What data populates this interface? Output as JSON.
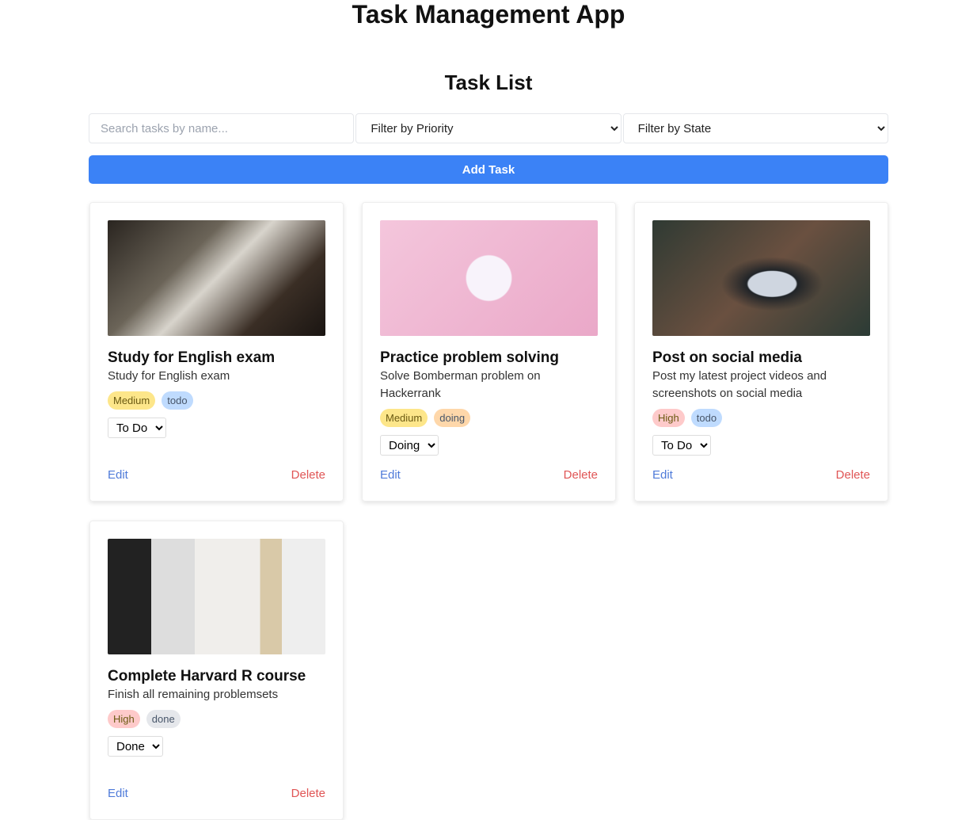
{
  "app_title": "Task Management App",
  "list_title": "Task List",
  "search": {
    "placeholder": "Search tasks by name..."
  },
  "filters": {
    "priority": "Filter by Priority",
    "state": "Filter by State"
  },
  "add_label": "Add Task",
  "edit_label": "Edit",
  "delete_label": "Delete",
  "colors": {
    "accent": "#3b82f6",
    "medium_bg": "#fde68a",
    "high_bg": "#fecaca",
    "todo_bg": "#bfdbfe",
    "doing_bg": "#fed7aa",
    "done_bg": "#e5e7eb"
  },
  "tasks": [
    {
      "title": "Study for English exam",
      "desc": "Study for English exam",
      "priority": "Medium",
      "status": "todo",
      "state": "To Do",
      "image": "book-photo"
    },
    {
      "title": "Practice problem solving",
      "desc": "Solve Bomberman problem on Hackerrank",
      "priority": "Medium",
      "status": "doing",
      "state": "Doing",
      "image": "code-illustration"
    },
    {
      "title": "Post on social media",
      "desc": "Post my latest project videos and screenshots on social media",
      "priority": "High",
      "status": "todo",
      "state": "To Do",
      "image": "phone-photo"
    },
    {
      "title": "Complete Harvard R course",
      "desc": "Finish all remaining problemsets",
      "priority": "High",
      "status": "done",
      "state": "Done",
      "image": "desk-photo"
    }
  ]
}
